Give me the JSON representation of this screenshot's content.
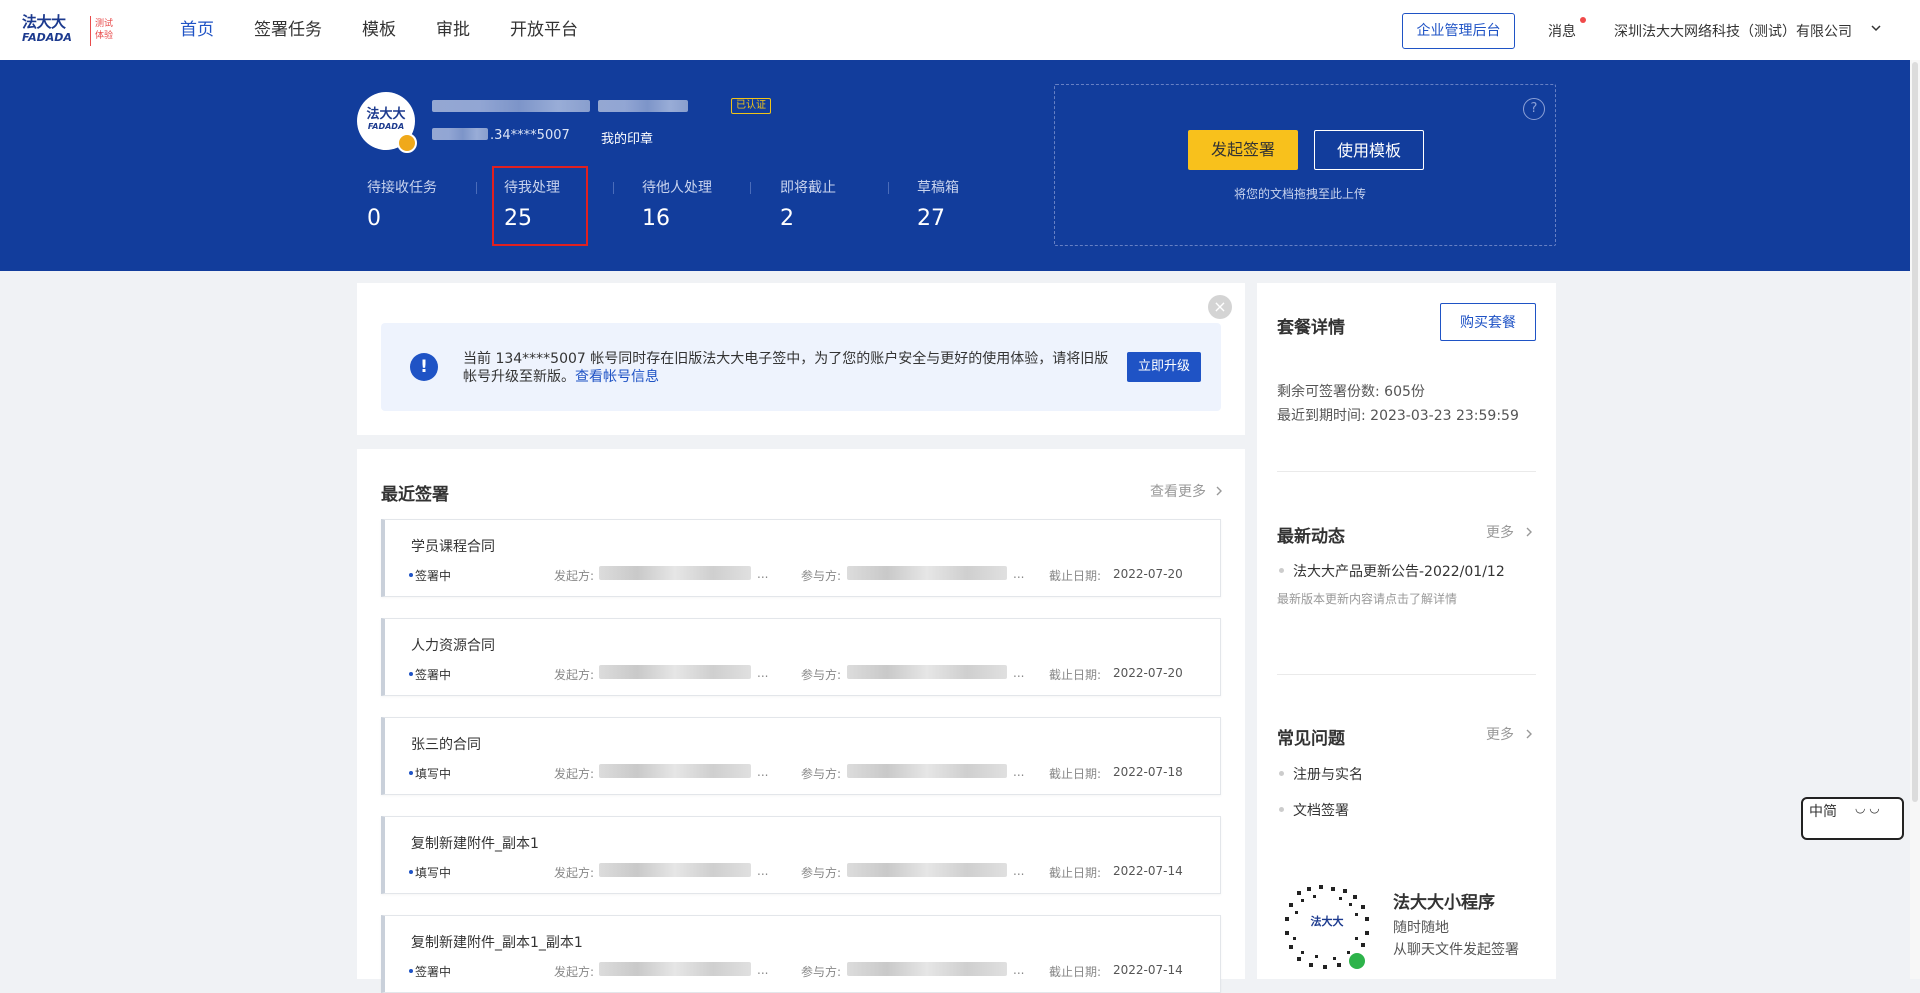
{
  "nav": {
    "logo_main": "法大大",
    "logo_sub": "FADADA",
    "logo_tag": "测试体验",
    "items": [
      "首页",
      "签署任务",
      "模板",
      "审批",
      "开放平台"
    ],
    "admin_button": "企业管理后台",
    "messages": "消息",
    "company": "深圳法大大网络科技（测试）有限公司"
  },
  "banner": {
    "avatar_main": "法大大",
    "avatar_sub": "FADADA",
    "cert_badge": "已认证",
    "phone": ".34****5007",
    "my_seal": "我的印章",
    "stats": [
      {
        "label": "待接收任务",
        "value": "0"
      },
      {
        "label": "待我处理",
        "value": "25"
      },
      {
        "label": "待他人处理",
        "value": "16"
      },
      {
        "label": "即将截止",
        "value": "2"
      },
      {
        "label": "草稿箱",
        "value": "27"
      }
    ],
    "start_sign": "发起签署",
    "use_template": "使用模板",
    "upload_hint": "将您的文档拖拽至此上传",
    "help": "?"
  },
  "notice": {
    "text": "当前 134****5007 帐号同时存在旧版法大大电子签中，为了您的账户安全与更好的使用体验，请将旧版帐号升级至新版。",
    "link": "查看帐号信息",
    "upgrade": "立即升级"
  },
  "recent": {
    "title": "最近签署",
    "more": "查看更多",
    "initiator_label": "发起方:",
    "participant_label": "参与方:",
    "deadline_label": "截止日期:",
    "items": [
      {
        "title": "学员课程合同",
        "status": "签署中",
        "date": "2022-07-20"
      },
      {
        "title": "人力资源合同",
        "status": "签署中",
        "date": "2022-07-20"
      },
      {
        "title": "张三的合同",
        "status": "填写中",
        "date": "2022-07-18"
      },
      {
        "title": "复制新建附件_副本1",
        "status": "填写中",
        "date": "2022-07-14"
      },
      {
        "title": "复制新建附件_副本1_副本1",
        "status": "签署中",
        "date": "2022-07-14"
      }
    ]
  },
  "side": {
    "package_title": "套餐详情",
    "buy": "购买套餐",
    "remaining": "剩余可签署份数: 605份",
    "expiry": "最近到期时间: 2023-03-23 23:59:59",
    "news_title": "最新动态",
    "news_more": "更多",
    "news_item": "法大大产品更新公告-2022/01/12",
    "news_sub": "最新版本更新内容请点击了解详情",
    "faq_title": "常见问题",
    "faq_more": "更多",
    "faq_items": [
      "注册与实名",
      "文档签署"
    ],
    "mini_title": "法大大小程序",
    "mini_sub1": "随时随地",
    "mini_sub2": "从聊天文件发起签署",
    "qr_text": "法大大"
  },
  "widget": {
    "text": "中简"
  }
}
